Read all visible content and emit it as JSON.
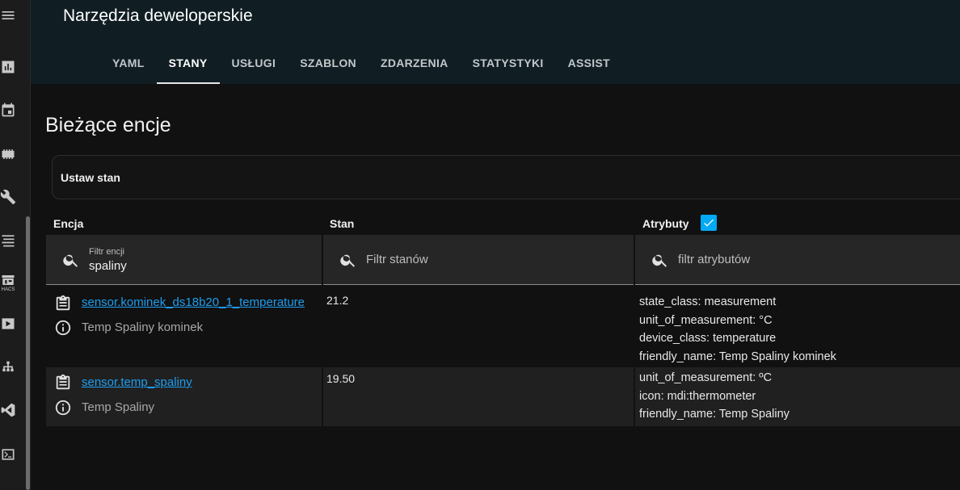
{
  "header": {
    "title": "Narzędzia deweloperskie",
    "tabs": [
      {
        "label": "YAML",
        "active": false
      },
      {
        "label": "STANY",
        "active": true
      },
      {
        "label": "USŁUGI",
        "active": false
      },
      {
        "label": "SZABLON",
        "active": false
      },
      {
        "label": "ZDARZENIA",
        "active": false
      },
      {
        "label": "STATYSTYKI",
        "active": false
      },
      {
        "label": "ASSIST",
        "active": false
      }
    ]
  },
  "sidebar": {
    "icons": [
      "menu-icon",
      "chart-icon",
      "calendar-icon",
      "memory-icon",
      "wrench-icon",
      "format-list-icon",
      "hacs-icon",
      "media-icon",
      "network-icon",
      "vscode-icon",
      "terminal-icon"
    ],
    "hacs_label": "HACS"
  },
  "main": {
    "page_title": "Bieżące encje",
    "set_state_label": "Ustaw stan",
    "columns": {
      "entity": "Encja",
      "state": "Stan",
      "attributes": "Atrybuty"
    },
    "attributes_checked": true,
    "filters": {
      "entity": {
        "label": "Filtr encji",
        "value": "spaliny"
      },
      "state": {
        "placeholder": "Filtr stanów"
      },
      "attributes": {
        "placeholder": "filtr atrybutów"
      }
    },
    "rows": [
      {
        "entity_id": "sensor.kominek_ds18b20_1_temperature",
        "friendly_name": "Temp Spaliny kominek",
        "state": "21.2",
        "attributes": [
          "state_class: measurement",
          "unit_of_measurement: °C",
          "device_class: temperature",
          "friendly_name: Temp Spaliny kominek"
        ]
      },
      {
        "entity_id": "sensor.temp_spaliny",
        "friendly_name": "Temp Spaliny",
        "state": "19.50",
        "attributes": [
          "unit_of_measurement: ºC",
          "icon: mdi:thermometer",
          "friendly_name: Temp Spaliny"
        ]
      }
    ]
  },
  "colors": {
    "accent": "#03a9f4",
    "link": "#1e9ef0",
    "header_bg": "#101e24"
  }
}
